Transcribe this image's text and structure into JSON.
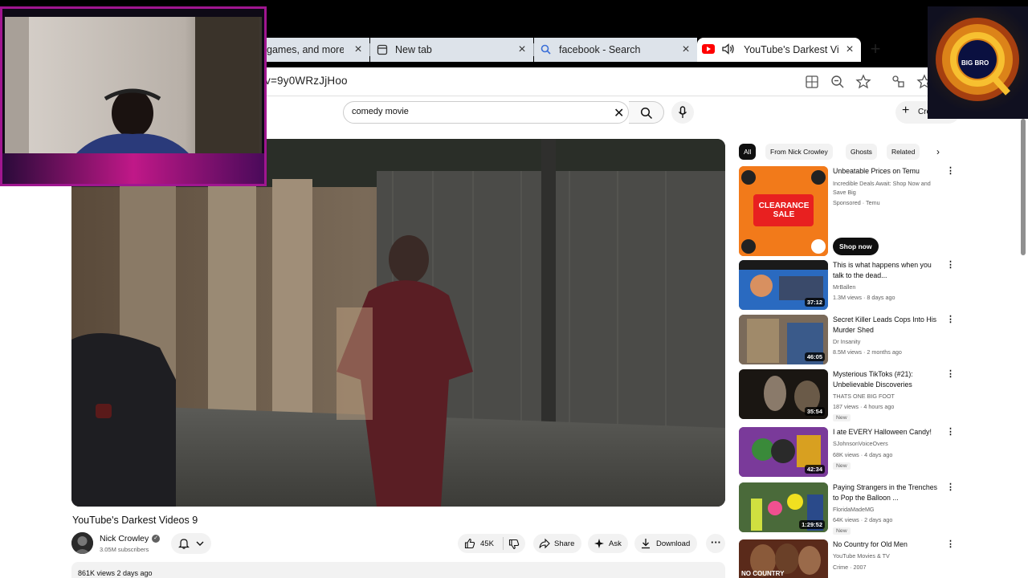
{
  "browser": {
    "tabs": [
      {
        "label": "games, and more g",
        "active": false
      },
      {
        "label": "New tab",
        "active": false
      },
      {
        "label": "facebook - Search",
        "active": false
      },
      {
        "label": "YouTube's Darkest Vid",
        "active": true
      }
    ],
    "url": "v=9y0WRzJjHoo"
  },
  "youtube": {
    "search": {
      "value": "comedy movie"
    },
    "create_label": "Cre"
  },
  "video": {
    "title": "YouTube's Darkest Videos 9",
    "channel": "Nick Crowley",
    "subscribers": "3.05M subscribers",
    "likes": "45K",
    "share_label": "Share",
    "ask_label": "Ask",
    "download_label": "Download",
    "views_date": "861K views  2 days ago"
  },
  "sidebar": {
    "chips": [
      "All",
      "From Nick Crowley",
      "Ghosts",
      "Related"
    ],
    "recommendations": [
      {
        "title": "Unbeatable Prices on Temu",
        "channel": "Incredible Deals Await: Shop Now and Save Big",
        "meta": "Sponsored · Temu",
        "duration": "",
        "badge": "",
        "cta": "Shop now",
        "thumb_text": "CLEARANCE SALE"
      },
      {
        "title": "This is what happens when you talk to the dead...",
        "channel": "MrBallen",
        "meta": "1.3M views · 8 days ago",
        "duration": "37:12",
        "badge": ""
      },
      {
        "title": "Secret Killer Leads Cops Into His Murder Shed",
        "channel": "Dr Insanity",
        "meta": "8.5M views · 2 months ago",
        "duration": "46:05",
        "badge": ""
      },
      {
        "title": "Mysterious TikToks (#21): Unbelievable Discoveries",
        "channel": "THATS ONE BIG FOOT",
        "meta": "187 views · 4 hours ago",
        "duration": "35:54",
        "badge": "New"
      },
      {
        "title": "I ate EVERY Halloween Candy!",
        "channel": "SJohnsonVoiceOvers",
        "meta": "68K views · 4 days ago",
        "duration": "42:34",
        "badge": "New"
      },
      {
        "title": "Paying Strangers in the Trenches to Pop the Balloon ...",
        "channel": "FloridaMadeMG",
        "meta": "64K views · 2 days ago",
        "duration": "1:29:52",
        "badge": "New"
      },
      {
        "title": "No Country for Old Men",
        "channel": "YouTube Movies & TV",
        "meta": "Crime · 2007",
        "duration": "",
        "badge": "",
        "thumb_text": "NO COUNTRY"
      }
    ]
  },
  "overlay": {
    "logo_text": "BIG BRO"
  },
  "colors": {
    "accent": "#ff0000",
    "webcam_border": "#a01690"
  }
}
